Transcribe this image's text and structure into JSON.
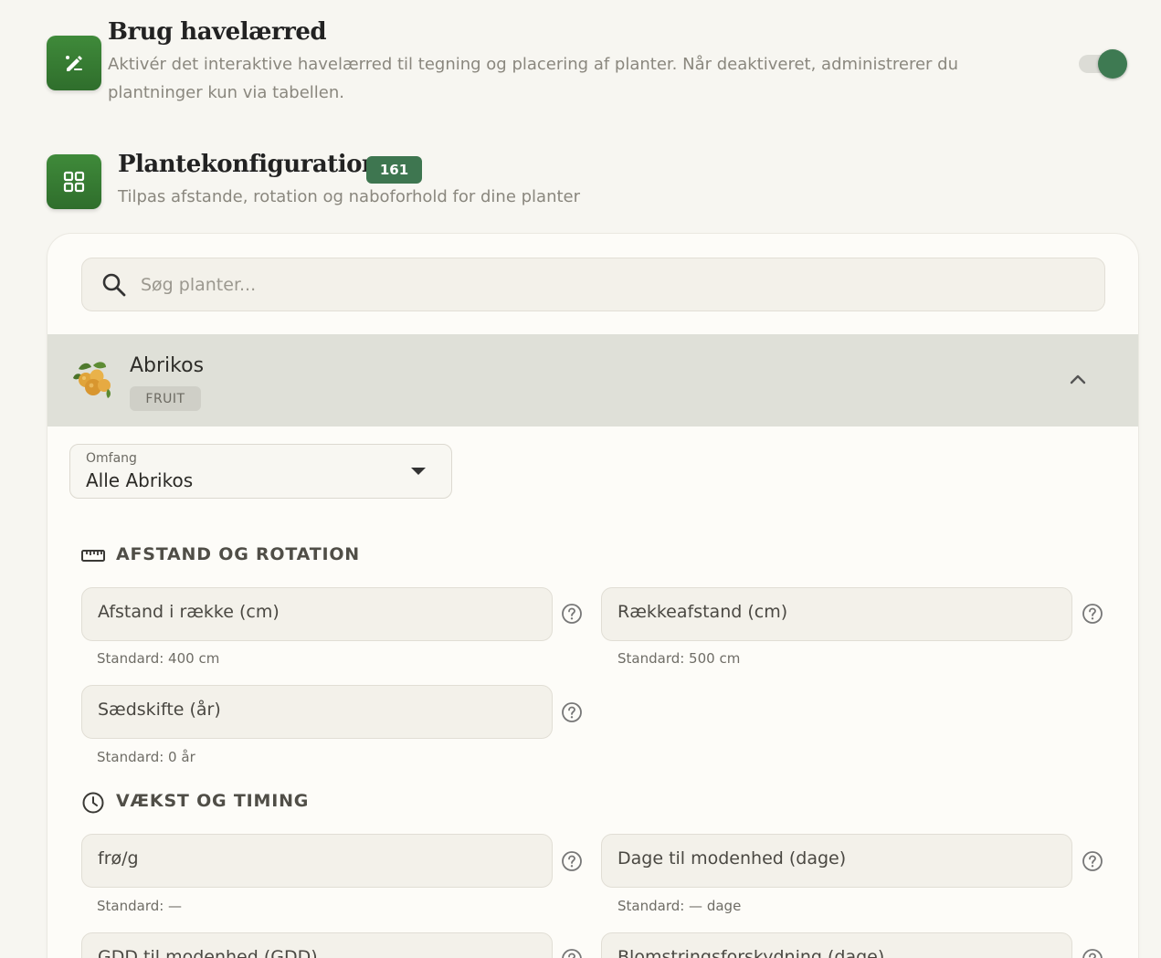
{
  "garden_canvas": {
    "title": "Brug havelærred",
    "description": "Aktivér det interaktive havelærred til tegning og placering af planter. Når deaktiveret, administrerer du plantninger kun via tabellen.",
    "toggle_on": true
  },
  "plant_config": {
    "title": "Plantekonfiguration",
    "count": "161",
    "description": "Tilpas afstande, rotation og naboforhold for dine planter"
  },
  "search": {
    "placeholder": "Søg planter..."
  },
  "plant": {
    "name": "Abrikos",
    "category": "FRUIT",
    "icon": "apricot-icon"
  },
  "scope": {
    "label": "Omfang",
    "value": "Alle Abrikos"
  },
  "groups": {
    "spacing": {
      "title": "AFSTAND OG ROTATION",
      "icon": "ruler-icon",
      "fields": [
        {
          "label": "Afstand i række (cm)",
          "default": "Standard: 400 cm"
        },
        {
          "label": "Rækkeafstand (cm)",
          "default": "Standard: 500 cm"
        },
        {
          "label": "Sædskifte (år)",
          "default": "Standard: 0 år"
        }
      ]
    },
    "growth": {
      "title": "VÆKST OG TIMING",
      "icon": "clock-icon",
      "fields": [
        {
          "label": "frø/g",
          "default": "Standard: —"
        },
        {
          "label": "Dage til modenhed (dage)",
          "default": "Standard: — dage"
        },
        {
          "label": "GDD til modenhed (GDD)",
          "default": ""
        },
        {
          "label": "Blomstringsforskydning (dage)",
          "default": ""
        }
      ]
    }
  },
  "colors": {
    "accent_green": "#3e7650",
    "background": "#f7f6f1"
  }
}
